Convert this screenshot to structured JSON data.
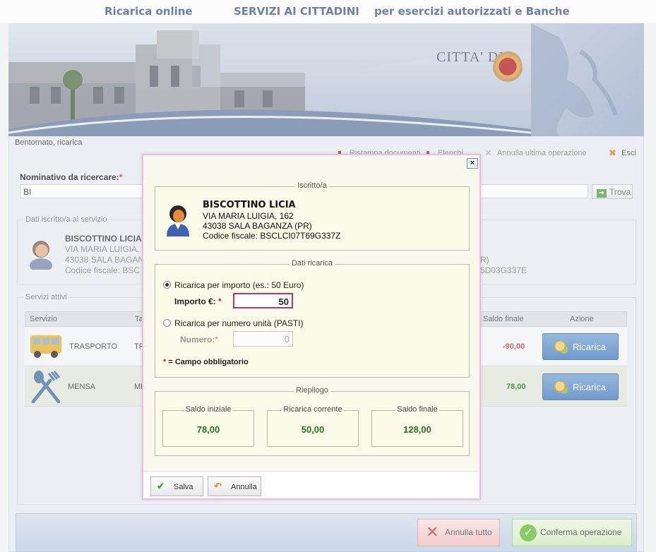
{
  "header": {
    "left_title": "Ricarica online",
    "center_title": "SERVIZI AI CITTADINI",
    "right_title": "per esercizi autorizzati e Banche"
  },
  "banner": {
    "city_label": "CITTA' DI"
  },
  "user_bar": {
    "welcome": "Bentornato, ricarica",
    "ristampa": "Ristampa documenti",
    "elenchi": "Elenchi",
    "annulla_ultima": "Annulla ultima operazione",
    "esci": "Esci"
  },
  "search": {
    "label": "Nominativo da ricercare:",
    "required_mark": "*",
    "value": "BI",
    "button": "Trova"
  },
  "background": {
    "iscritto_legend": "Dati iscritto/a al servizio",
    "name": "BISCOTTINO LICIA",
    "address": "VIA MARIA LUIGIA, 1",
    "city": "43038 SALA BAGAN",
    "cf": "Codice fiscale: BSC",
    "right_frag_1": "R)",
    "right_frag_2": "5D03G337E",
    "servizi_legend": "Servizi attivi",
    "table_headers": [
      "Servizio",
      "Ta",
      "Saldo finale",
      "Azione"
    ],
    "rows": [
      {
        "service": "TRASPORTO",
        "code": "TR",
        "saldo_finale": "-90,00",
        "action": "Ricarica"
      },
      {
        "service": "MENSA",
        "code": "ME",
        "saldo_finale": "78,00",
        "action": "Ricarica"
      }
    ],
    "annulla_tutto": "Annulla tutto",
    "conferma": "Conferma operazione"
  },
  "modal": {
    "close": "×",
    "iscritto": {
      "legend": "Iscritto/a",
      "name": "BISCOTTINO LICIA",
      "address": "VIA MARIA LUIGIA, 162",
      "city": "43038 SALA BAGANZA (PR)",
      "cf": "Codice fiscale: BSCLCI07T69G337Z"
    },
    "ricarica": {
      "legend": "Dati ricarica",
      "option_importo": "Ricarica per importo (es.: 50 Euro)",
      "importo_label": "Importo €:",
      "importo_value": "50",
      "option_unita": "Ricarica per numero unità (PASTI)",
      "numero_label": "Numero:",
      "numero_value": "0",
      "required_note": "= Campo obbligatorio",
      "required_mark": "*"
    },
    "riepilogo": {
      "legend": "Riepilogo",
      "saldo_iniziale_label": "Saldo iniziale",
      "saldo_iniziale": "78,00",
      "ricarica_corrente_label": "Ricarica corrente",
      "ricarica_corrente": "50,00",
      "saldo_finale_label": "Saldo finale",
      "saldo_finale": "128,00"
    },
    "buttons": {
      "salva": "Salva",
      "annulla": "Annulla"
    }
  },
  "colors": {
    "title_blue": "#4a5f95",
    "positive_green": "#1d7a1d",
    "negative_red": "#d23b3b",
    "modal_border": "#e8bfe6",
    "required_red": "#dd2222"
  }
}
